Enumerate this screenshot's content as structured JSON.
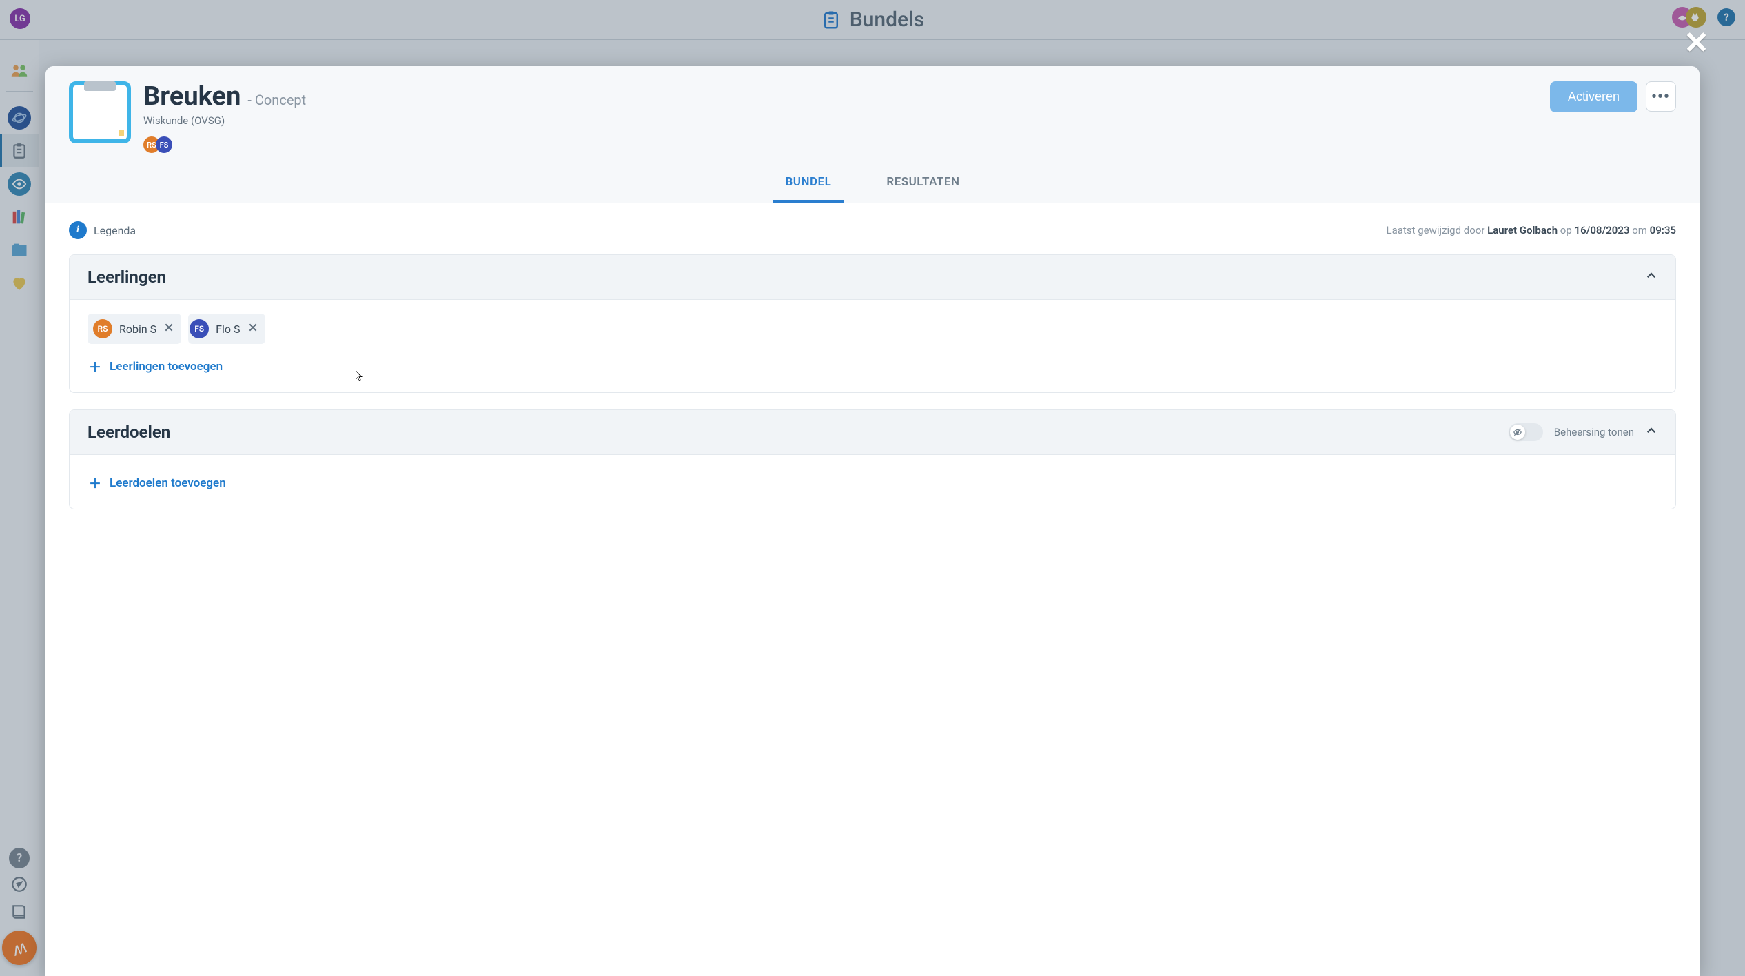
{
  "header": {
    "page_title": "Bundels",
    "user_initials": "LG"
  },
  "modal": {
    "title": "Breuken",
    "status_prefix": "- ",
    "status": "Concept",
    "subject": "Wiskunde (OVSG)",
    "student_badges": [
      {
        "initials": "RS",
        "cls": "rs"
      },
      {
        "initials": "FS",
        "cls": "fs"
      }
    ],
    "activate_label": "Activeren",
    "tabs": {
      "bundel": "BUNDEL",
      "resultaten": "RESULTATEN"
    },
    "legend_label": "Legenda",
    "meta": {
      "prefix": "Laatst gewijzigd door ",
      "user": "Lauret Golbach",
      "mid1": " op ",
      "date": "16/08/2023",
      "mid2": " om ",
      "time": "09:35"
    },
    "panels": {
      "leerlingen": {
        "title": "Leerlingen",
        "chips": [
          {
            "initials": "RS",
            "name": "Robin S",
            "cls": "rs"
          },
          {
            "initials": "FS",
            "name": "Flo S",
            "cls": "fs"
          }
        ],
        "add_label": "Leerlingen toevoegen"
      },
      "leerdoelen": {
        "title": "Leerdoelen",
        "toggle_label": "Beheersing tonen",
        "add_label": "Leerdoelen toevoegen"
      }
    }
  }
}
